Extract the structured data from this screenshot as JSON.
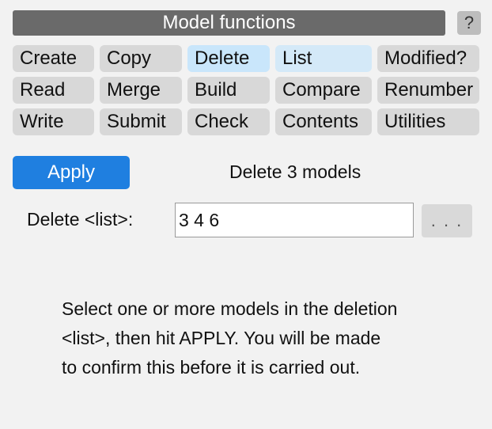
{
  "panel": {
    "title": "Model functions",
    "help_label": "?"
  },
  "functions": [
    [
      "Create",
      "Copy",
      "Delete",
      "List",
      "Modified?"
    ],
    [
      "Read",
      "Merge",
      "Build",
      "Compare",
      "Renumber"
    ],
    [
      "Write",
      "Submit",
      "Check",
      "Contents",
      "Utilities"
    ]
  ],
  "selected_function": "Delete",
  "hovered_function": "List",
  "action": {
    "apply_label": "Apply",
    "status": "Delete 3 models"
  },
  "delete_list": {
    "label": "Delete <list>:",
    "value": "3 4 6",
    "browse_label": ". . ."
  },
  "help": {
    "lines": [
      "Select one or more models in the deletion",
      "<list>, then hit APPLY.  You will be made",
      "to confirm this before it is carried out."
    ]
  },
  "colors": {
    "title_bg": "#6a6a6a",
    "button_bg": "#d8d8d8",
    "selected_bg": "#c9e6fb",
    "apply_bg": "#1f7fe0"
  }
}
